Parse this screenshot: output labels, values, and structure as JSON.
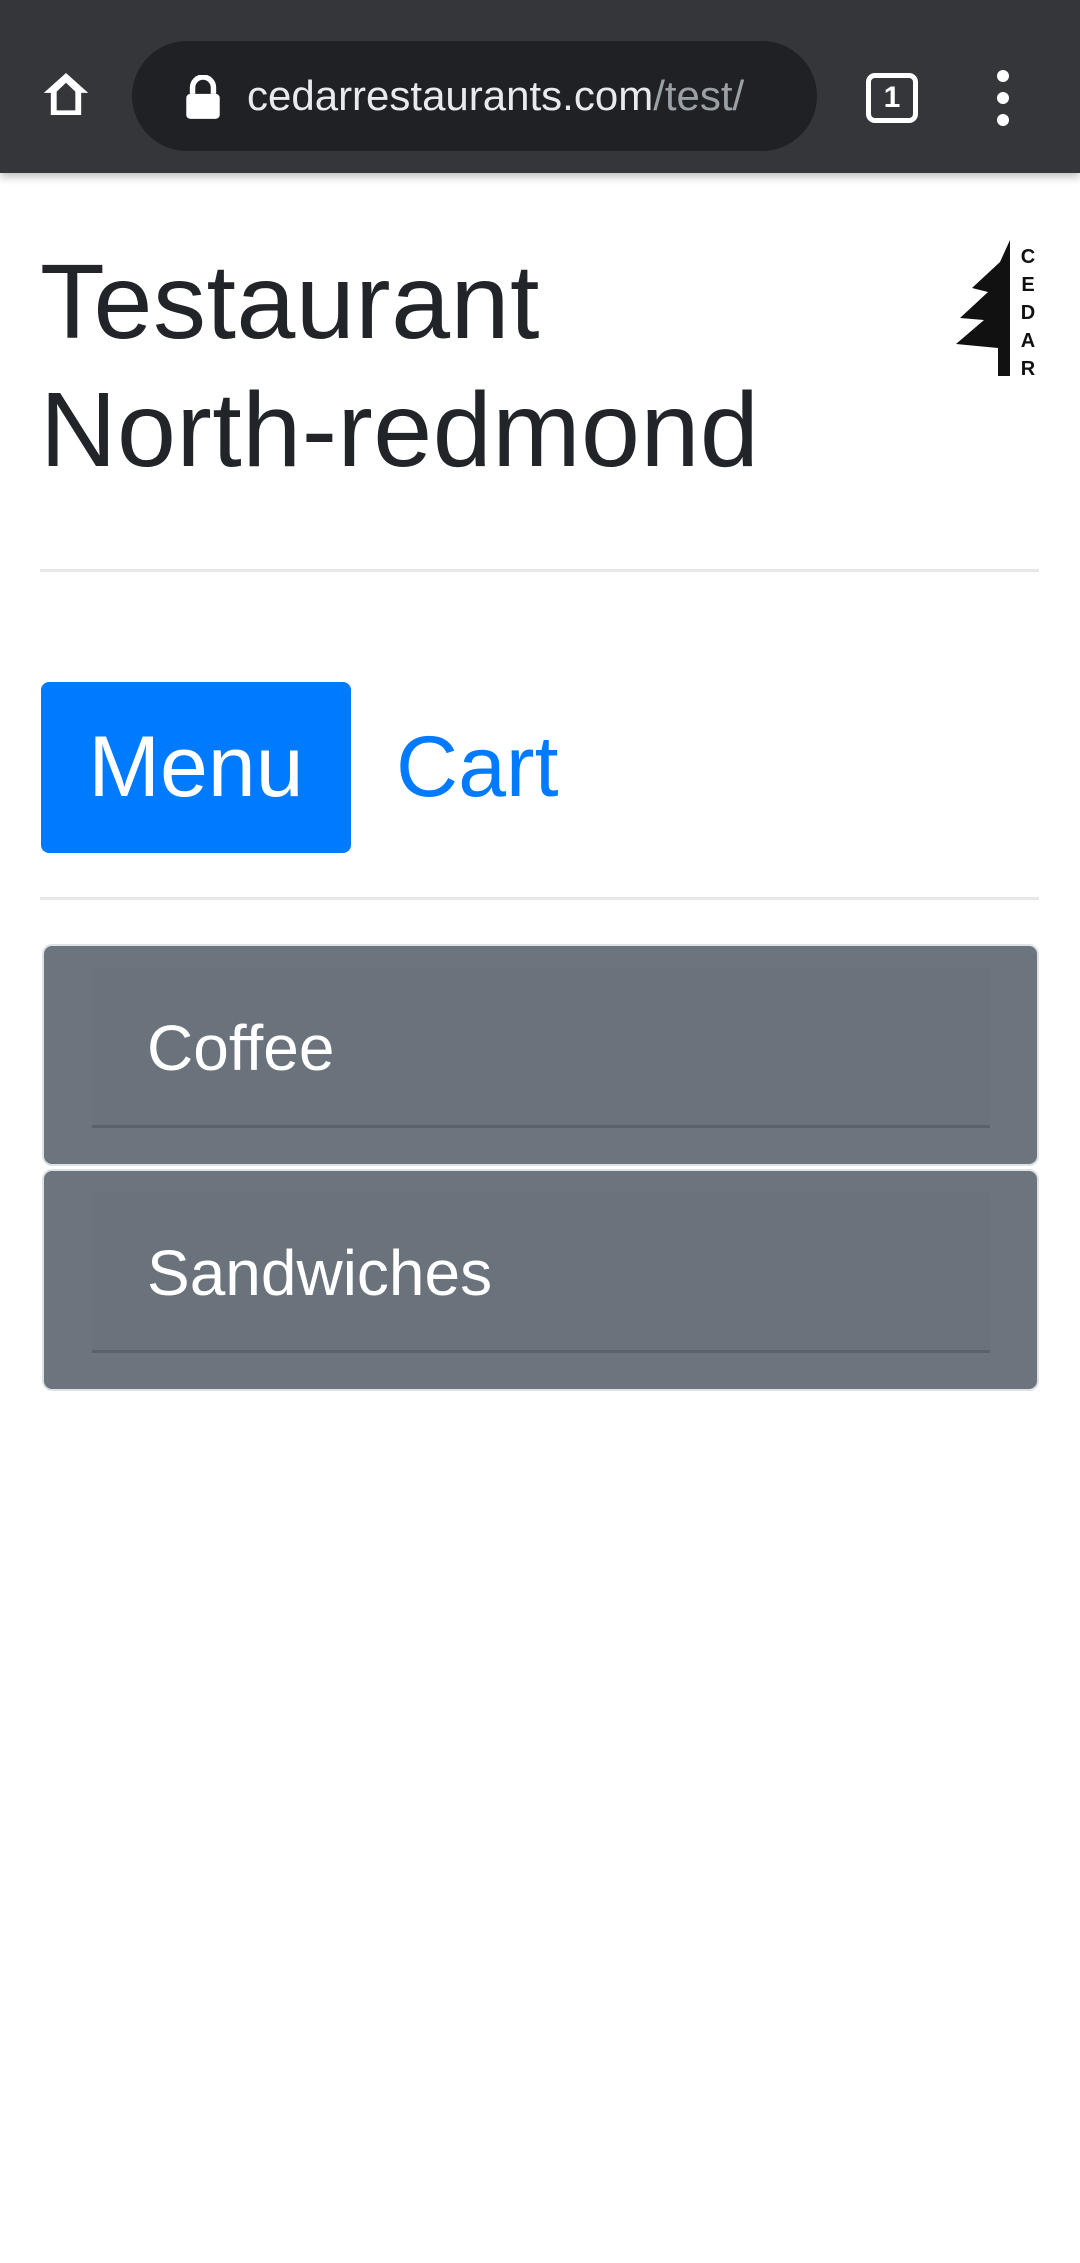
{
  "browser": {
    "url_host": "cedarrestaurants.com",
    "url_path": "/test/",
    "tab_count": "1",
    "icons": [
      "home-icon",
      "lock-icon",
      "tab-switcher-icon",
      "more-vert-icon"
    ]
  },
  "header": {
    "title_line1": "Testaurant",
    "title_line2": "North-redmond",
    "logo_letters": "CEDAR"
  },
  "nav": {
    "menu_label": "Menu",
    "cart_label": "Cart",
    "active": "Menu"
  },
  "categories": [
    {
      "label": "Coffee"
    },
    {
      "label": "Sandwiches"
    }
  ],
  "colors": {
    "primary": "#007bff",
    "card": "#6c757d",
    "title": "#212529",
    "browser_bar": "#35363a"
  }
}
